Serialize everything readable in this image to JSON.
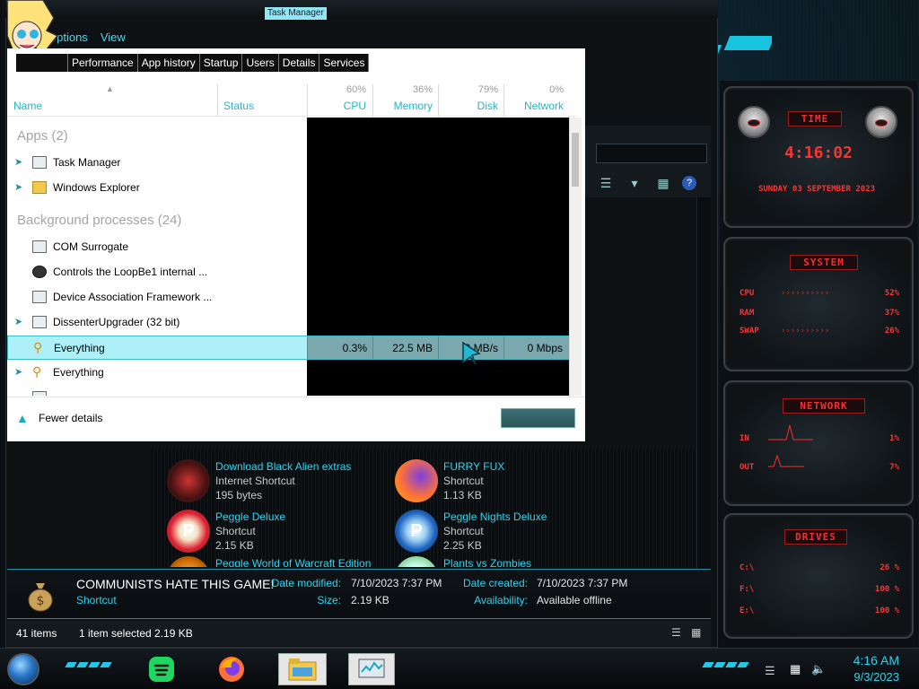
{
  "task_manager": {
    "title": "Task Manager",
    "menu": [
      "Options",
      "View"
    ],
    "tabs": [
      "Performance",
      "App history",
      "Startup",
      "Users",
      "Details",
      "Services"
    ],
    "columns": {
      "name": "Name",
      "status": "Status",
      "cpu": {
        "label": "CPU",
        "pct": "60%"
      },
      "memory": {
        "label": "Memory",
        "pct": "36%"
      },
      "disk": {
        "label": "Disk",
        "pct": "79%"
      },
      "network": {
        "label": "Network",
        "pct": "0%"
      }
    },
    "apps_group": "Apps (2)",
    "apps": [
      "Task Manager",
      "Windows Explorer"
    ],
    "background_group": "Background processes (24)",
    "background": [
      {
        "name": "COM Surrogate"
      },
      {
        "name": "Controls the LoopBe1 internal ..."
      },
      {
        "name": "Device Association Framework ..."
      },
      {
        "name": "DissenterUpgrader (32 bit)"
      },
      {
        "name": "Everything",
        "cpu": "0.3%",
        "memory": "22.5 MB",
        "disk": "0 MB/s",
        "network": "0 Mbps",
        "selected": true
      },
      {
        "name": "Everything"
      }
    ],
    "fewer_details": "Fewer details",
    "accent": "#28b3c9"
  },
  "explorer": {
    "menu": [
      "Options",
      "View"
    ],
    "files": [
      {
        "name": "Download Black Alien extras",
        "type": "Internet Shortcut",
        "size": "195 bytes",
        "icon": "black-alien-icon"
      },
      {
        "name": "FURRY FUX",
        "type": "Shortcut",
        "size": "1.13 KB",
        "icon": "firefox-icon"
      },
      {
        "name": "Peggle Deluxe",
        "type": "Shortcut",
        "size": "2.15 KB",
        "icon": "peggle-icon"
      },
      {
        "name": "Peggle Nights Deluxe",
        "type": "Shortcut",
        "size": "2.25 KB",
        "icon": "peggle-nights-icon"
      },
      {
        "name": "Peggle World of Warcraft Edition",
        "icon": "peggle-wow-icon"
      },
      {
        "name": "Plants vs Zombies",
        "icon": "pvz-icon"
      }
    ],
    "details": {
      "name": "COMMUNISTS HATE THIS GAME!",
      "type": "Shortcut",
      "date_modified_label": "Date modified:",
      "date_modified": "7/10/2023 7:37 PM",
      "size_label": "Size:",
      "size": "2.19 KB",
      "date_created_label": "Date created:",
      "date_created": "7/10/2023 7:37 PM",
      "availability_label": "Availability:",
      "availability": "Available offline"
    },
    "status": {
      "items": "41 items",
      "selected": "1 item selected  2.19 KB"
    }
  },
  "gadget": {
    "time_head": "TIME",
    "time": "4:16:02",
    "date": "SUNDAY 03 SEPTEMBER 2023",
    "system_head": "SYSTEM",
    "system": [
      {
        "label": "CPU",
        "value": "52%"
      },
      {
        "label": "RAM",
        "value": "37%"
      },
      {
        "label": "SWAP",
        "value": "26%"
      }
    ],
    "network_head": "NETWORK",
    "network": [
      {
        "label": "IN",
        "value": "1%"
      },
      {
        "label": "OUT",
        "value": "7%"
      }
    ],
    "drives_head": "DRIVES",
    "drives": [
      {
        "label": "C:\\",
        "value": "26 %"
      },
      {
        "label": "F:\\",
        "value": "100 %"
      },
      {
        "label": "E:\\",
        "value": "100 %"
      }
    ],
    "color": "#ff2a2a"
  },
  "taskbar": {
    "time": "4:16 AM",
    "date": "9/3/2023",
    "apps": [
      "spotify-icon",
      "firefox-icon",
      "file-explorer-icon",
      "task-manager-icon"
    ]
  }
}
